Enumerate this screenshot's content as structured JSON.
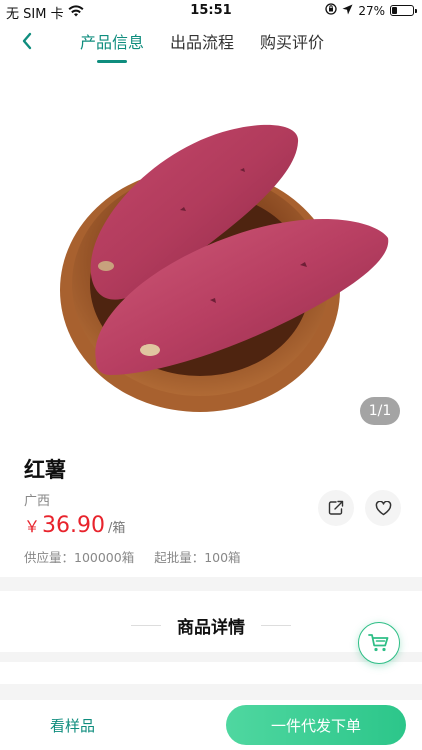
{
  "status_bar": {
    "carrier": "无 SIM 卡",
    "time": "15:51",
    "battery": "27%",
    "battery_level": 0.27
  },
  "nav": {
    "tabs": [
      {
        "label": "产品信息",
        "active": true
      },
      {
        "label": "出品流程",
        "active": false
      },
      {
        "label": "购买评价",
        "active": false
      }
    ]
  },
  "gallery": {
    "counter": "1/1"
  },
  "product": {
    "name": "红薯",
    "origin": "广西",
    "currency": "￥",
    "price": "36.90",
    "unit": "/箱",
    "supply_label": "供应量：100000箱",
    "min_batch_label": "起批量：100箱"
  },
  "detail": {
    "title": "商品详情"
  },
  "bottom_bar": {
    "sample_label": "看样品",
    "buy_label": "一件代发下单"
  },
  "colors": {
    "accent": "#0f8d7e",
    "price": "#e8232c",
    "button": "#2cc68a"
  },
  "icons": [
    "back-chevron-icon",
    "share-icon",
    "heart-icon",
    "cart-icon",
    "wifi-icon",
    "location-icon"
  ]
}
